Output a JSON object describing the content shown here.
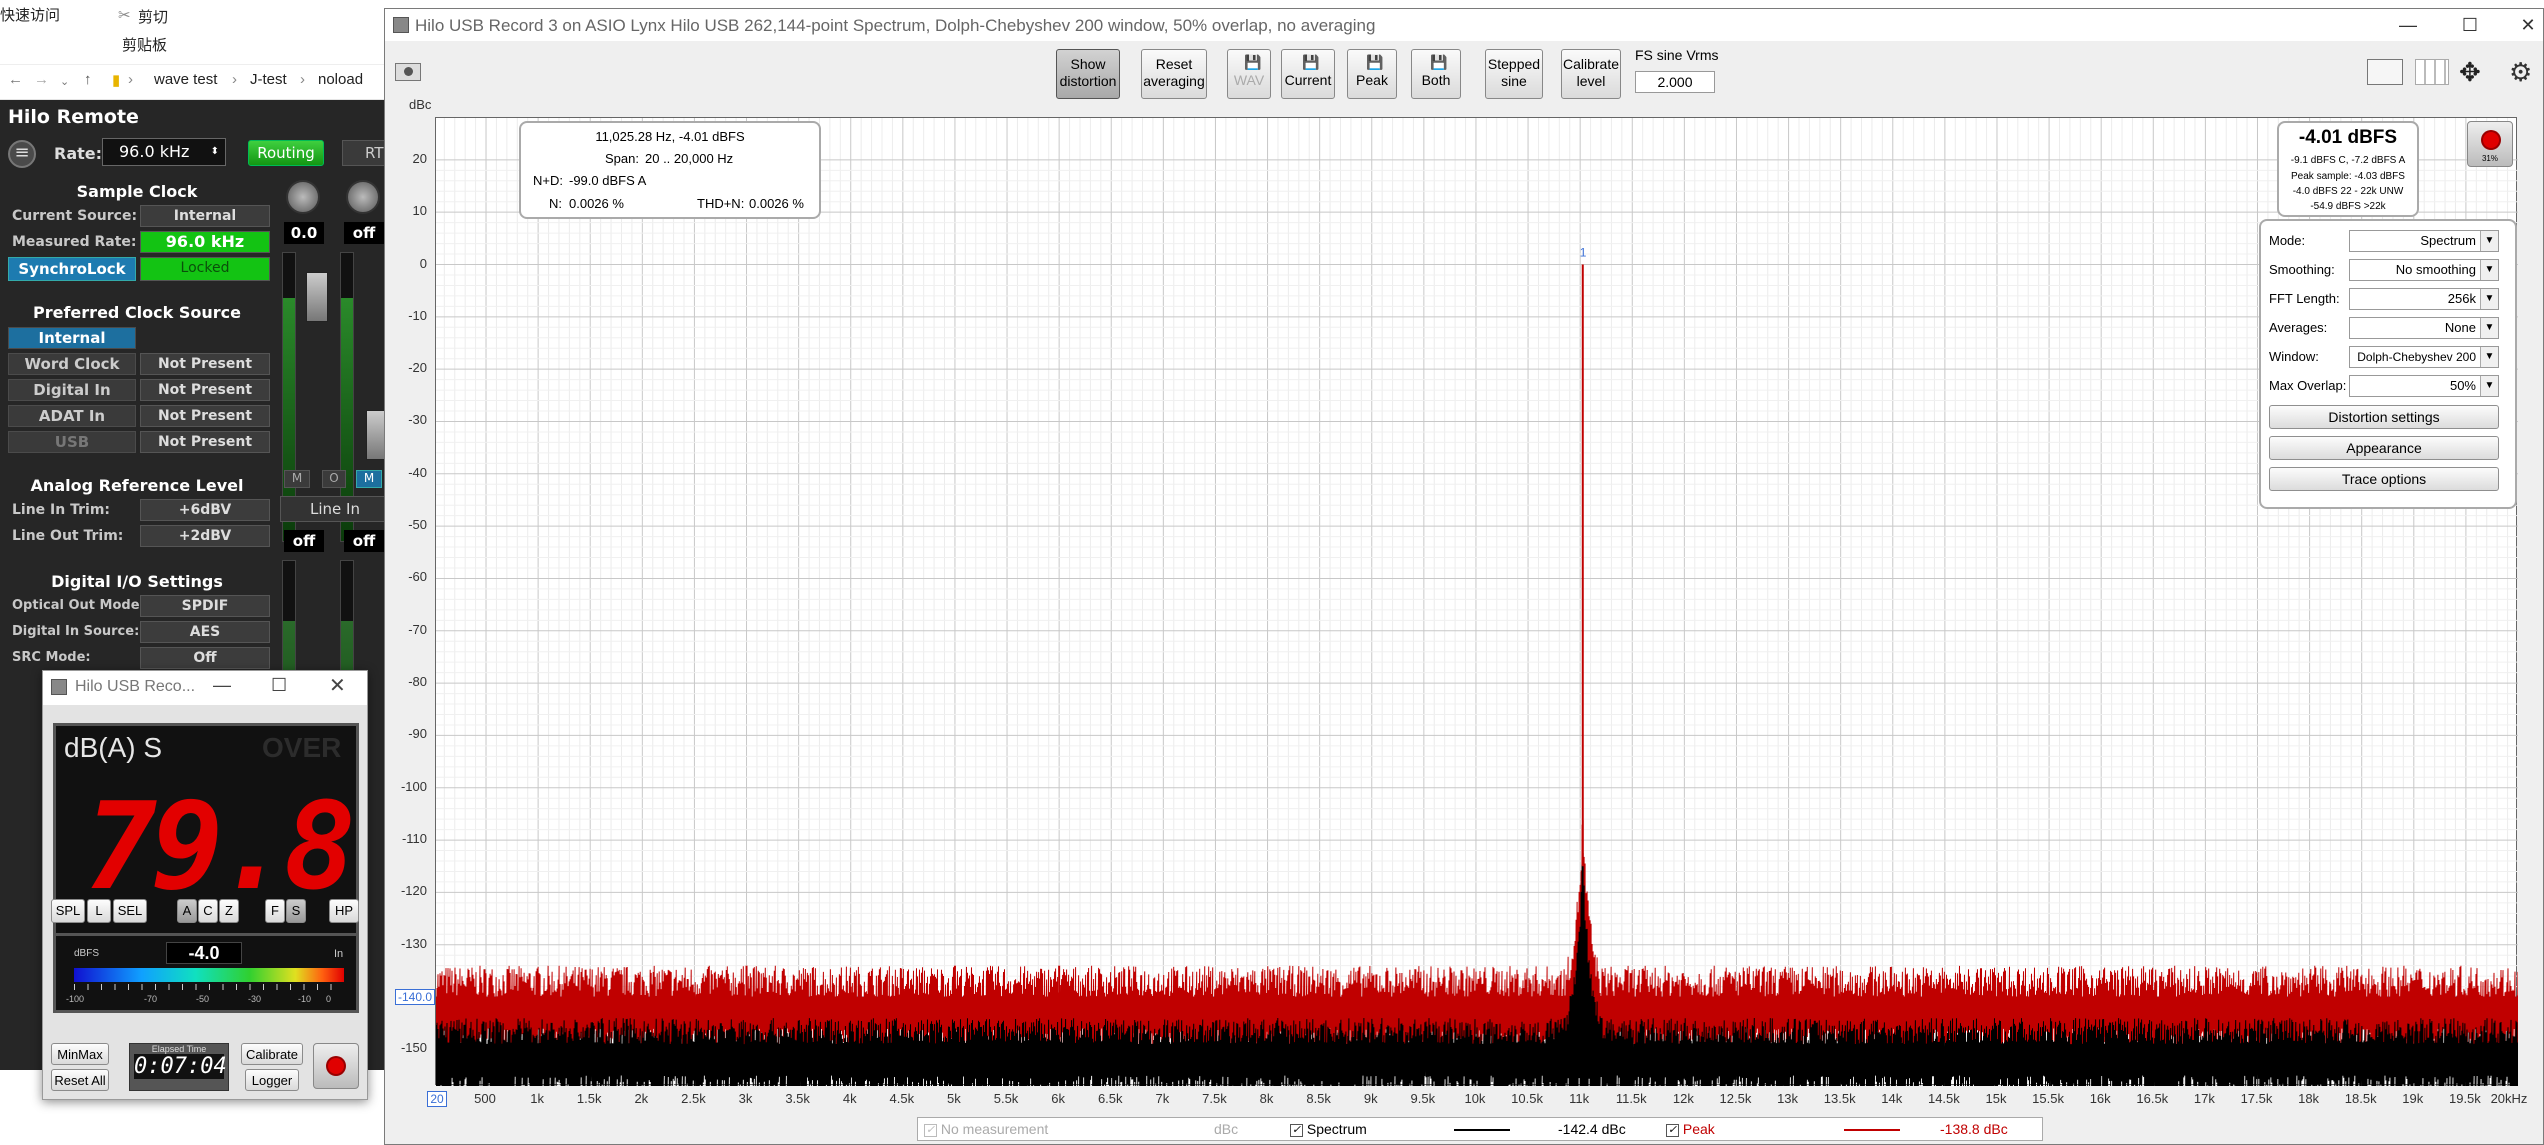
{
  "explorer": {
    "quick_access": "快速访问",
    "cut": "剪切",
    "clipboard": "剪贴板",
    "path": [
      "wave test",
      "J-test",
      "noload"
    ]
  },
  "remote": {
    "title": "Hilo Remote",
    "rate_label": "Rate:",
    "rate_value": "96.0 kHz",
    "routing": "Routing",
    "rt": "RT",
    "sample_clock": "Sample Clock",
    "current_source_label": "Current Source:",
    "current_source": "Internal",
    "measured_rate_label": "Measured Rate:",
    "measured_rate": "96.0 kHz",
    "synchrolock": "SynchroLock",
    "locked": "Locked",
    "preferred_clock": "Preferred Clock Source",
    "sources": [
      {
        "name": "Internal",
        "status": ""
      },
      {
        "name": "Word Clock",
        "status": "Not Present"
      },
      {
        "name": "Digital In",
        "status": "Not Present"
      },
      {
        "name": "ADAT In",
        "status": "Not Present"
      },
      {
        "name": "USB",
        "status": "Not Present"
      }
    ],
    "analog_ref": "Analog Reference Level",
    "line_in_trim_label": "Line In Trim:",
    "line_in_trim": "+6dBV",
    "line_out_trim_label": "Line Out Trim:",
    "line_out_trim": "+2dBV",
    "digital_io": "Digital I/O Settings",
    "optical_label": "Optical Out Mode:",
    "optical": "SPDIF",
    "digital_in_label": "Digital In Source:",
    "digital_in": "AES",
    "src_label": "SRC Mode:",
    "src": "Off",
    "knob1": "0.0",
    "knob2": "off",
    "m1": "M",
    "o": "O",
    "m2": "M",
    "line_in": "Line In",
    "off1": "off",
    "off2": "off"
  },
  "spl": {
    "title": "Hilo USB Reco...",
    "mode": "dB(A) S",
    "over": "OVER",
    "reading": "79.8",
    "buttons": [
      "SPL",
      "L",
      "SEL",
      "A",
      "C",
      "Z",
      "F",
      "S",
      "HP"
    ],
    "meter_unit": "dBFS",
    "meter_value": "-4.0",
    "meter_in": "In",
    "meter_ticks": [
      "-100",
      "-70",
      "-50",
      "-30",
      "-10",
      "0"
    ],
    "minmax": "MinMax",
    "reset_all": "Reset All",
    "elapsed_label": "Elapsed Time",
    "elapsed": "0:07:04",
    "calibrate": "Calibrate",
    "logger": "Logger"
  },
  "main": {
    "title": "Hilo USB Record 3 on ASIO Lynx Hilo USB 262,144-point Spectrum, Dolph-Chebyshev 200 window, 50% overlap, no averaging",
    "toolbar": {
      "show_distortion": "Show distortion",
      "reset_averaging": "Reset averaging",
      "wav": "WAV",
      "current": "Current",
      "peak": "Peak",
      "both": "Both",
      "stepped_sine": "Stepped sine",
      "calibrate_level": "Calibrate level"
    },
    "fs_label": "FS sine Vrms",
    "fs_value": "2.000",
    "y_unit": "dBc",
    "info": {
      "freq": "11,025.28 Hz, -4.01 dBFS",
      "span_label": "Span:",
      "span": "20 .. 20,000 Hz",
      "nd_label": "N+D:",
      "nd": "-99.0 dBFS A",
      "n_label": "N:",
      "n": "0.0026 %",
      "thdn_label": "THD+N:",
      "thdn": "0.0026 %"
    },
    "level": {
      "main": "-4.01 dBFS",
      "l1": "-9.1 dBFS C, -7.2 dBFS A",
      "l2": "Peak sample: -4.03 dBFS",
      "l3": "-4.0 dBFS 22 - 22k UNW",
      "l4": "-54.9 dBFS >22k"
    },
    "rec_pct": "31%",
    "settings": [
      {
        "label": "Mode:",
        "value": "Spectrum"
      },
      {
        "label": "Smoothing:",
        "value": "No  smoothing"
      },
      {
        "label": "FFT Length:",
        "value": "256k"
      },
      {
        "label": "Averages:",
        "value": "None"
      },
      {
        "label": "Window:",
        "value": "Dolph-Chebyshev 200"
      },
      {
        "label": "Max Overlap:",
        "value": "50%"
      }
    ],
    "distortion_settings": "Distortion settings",
    "appearance": "Appearance",
    "trace_options": "Trace options",
    "legend": {
      "no_measurement": "No measurement",
      "dbc": "dBc",
      "spectrum": "Spectrum",
      "spectrum_val": "-142.4 dBc",
      "peak": "Peak",
      "peak_val": "-138.8 dBc"
    },
    "marker_label": "1",
    "ref_line": "-140.0",
    "x_first": "20"
  },
  "chart_data": {
    "type": "line",
    "xlabel": "",
    "ylabel": "dBc",
    "xlim": [
      20,
      20000
    ],
    "ylim": [
      -157,
      28
    ],
    "grid": true,
    "yticks": [
      20,
      10,
      0,
      -10,
      -20,
      -30,
      -40,
      -50,
      -60,
      -70,
      -80,
      -90,
      -100,
      -110,
      -120,
      -130,
      -140,
      -150
    ],
    "xtick_labels": [
      "500",
      "1k",
      "1.5k",
      "2k",
      "2.5k",
      "3k",
      "3.5k",
      "4k",
      "4.5k",
      "5k",
      "5.5k",
      "6k",
      "6.5k",
      "7k",
      "7.5k",
      "8k",
      "8.5k",
      "9k",
      "9.5k",
      "10k",
      "10.5k",
      "11k",
      "11.5k",
      "12k",
      "12.5k",
      "13k",
      "13.5k",
      "14k",
      "14.5k",
      "15k",
      "15.5k",
      "16k",
      "16.5k",
      "17k",
      "17.5k",
      "18k",
      "18.5k",
      "19k",
      "19.5k",
      "20kHz"
    ],
    "xtick_values": [
      500,
      1000,
      1500,
      2000,
      2500,
      3000,
      3500,
      4000,
      4500,
      5000,
      5500,
      6000,
      6500,
      7000,
      7500,
      8000,
      8500,
      9000,
      9500,
      10000,
      10500,
      11000,
      11500,
      12000,
      12500,
      13000,
      13500,
      14000,
      14500,
      15000,
      15500,
      16000,
      16500,
      17000,
      17500,
      18000,
      18500,
      19000,
      19500,
      20000
    ],
    "fundamental": {
      "x": 11025,
      "y": 0
    },
    "series": [
      {
        "name": "Peak",
        "color": "#c00000",
        "floor": -140,
        "skirt_peak": -108,
        "spurs": [
          {
            "x": 1000,
            "y": -136
          },
          {
            "x": 3000,
            "y": -134
          },
          {
            "x": 4000,
            "y": -138
          },
          {
            "x": 5000,
            "y": -134
          },
          {
            "x": 6000,
            "y": -134
          },
          {
            "x": 7000,
            "y": -140
          },
          {
            "x": 16500,
            "y": -140
          },
          {
            "x": 18000,
            "y": -140
          }
        ]
      },
      {
        "name": "Spectrum",
        "color": "#000000",
        "floor": -149,
        "skirt_peak": -115
      }
    ]
  }
}
